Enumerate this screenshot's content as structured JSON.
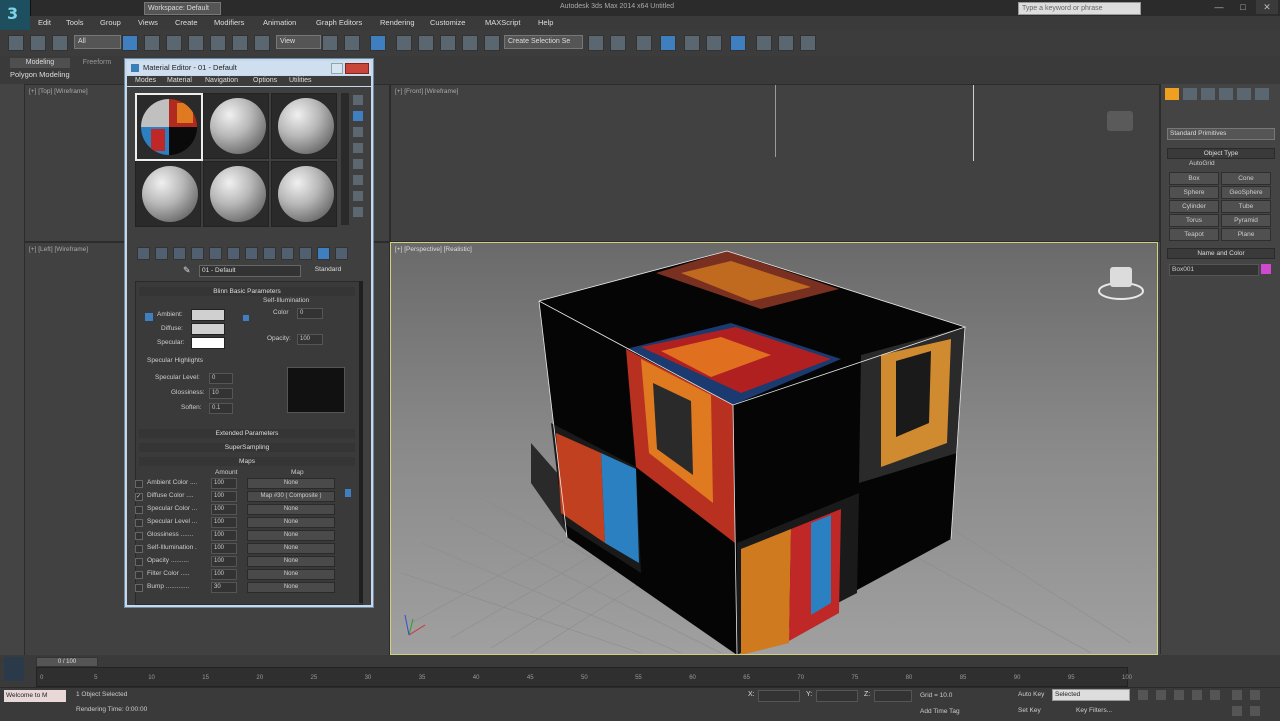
{
  "titlebar": {
    "workspace": "Workspace: Default",
    "app_title": "Autodesk 3ds Max 2014 x64     Untitled",
    "search_placeholder": "Type a keyword or phrase",
    "min": "—",
    "max": "□",
    "close": "✕"
  },
  "menu": [
    "Edit",
    "Tools",
    "Group",
    "Views",
    "Create",
    "Modifiers",
    "Animation",
    "Graph Editors",
    "Rendering",
    "Customize",
    "MAXScript",
    "Help"
  ],
  "toolbar": {
    "selection_filter": "All",
    "ref_coord": "View",
    "named_selection": "Create Selection Se"
  },
  "ribbon": {
    "tab_modeling": "Modeling",
    "tab_freeform": "Freeform",
    "poly_modeling": "Polygon Modeling"
  },
  "viewports": {
    "top": "[+] [Top] [Wireframe]",
    "front": "[+] [Front] [Wireframe]",
    "left": "[+] [Left] [Wireframe]",
    "persp": "[+] [Perspective] [Realistic]"
  },
  "command_panel": {
    "dropdown": "Standard Primitives",
    "object_type": "Object Type",
    "autogrid": "AutoGrid",
    "buttons": [
      "Box",
      "Cone",
      "Sphere",
      "GeoSphere",
      "Cylinder",
      "Tube",
      "Torus",
      "Pyramid",
      "Teapot",
      "Plane"
    ],
    "name_color": "Name and Color",
    "name_value": "Box001",
    "name_color_hex": "#d04ad0"
  },
  "material_editor": {
    "title": "Material Editor - 01 - Default",
    "menu": [
      "Modes",
      "Material",
      "Navigation",
      "Options",
      "Utilities"
    ],
    "material_name": "01 - Default",
    "material_type": "Standard",
    "blinn_basic": "Blinn Basic Parameters",
    "self_illum": "Self-Illumination",
    "ambient": "Ambient:",
    "diffuse": "Diffuse:",
    "specular": "Specular:",
    "color_label": "Color",
    "color_value": "0",
    "opacity_label": "Opacity:",
    "opacity_value": "100",
    "specular_highlights": "Specular Highlights",
    "spec_level": "Specular Level:",
    "spec_level_value": "0",
    "glossiness": "Glossiness:",
    "glossiness_value": "10",
    "soften": "Soften:",
    "soften_value": "0.1",
    "extended": "Extended Parameters",
    "supersampling": "SuperSampling",
    "maps": "Maps",
    "amount": "Amount",
    "map": "Map",
    "maps_rows": [
      {
        "name": "Ambient Color ....",
        "amount": "100",
        "map": "None",
        "checked": false
      },
      {
        "name": "Diffuse Color ....",
        "amount": "100",
        "map": "Map #30 ( Composite )",
        "checked": true
      },
      {
        "name": "Specular Color ...",
        "amount": "100",
        "map": "None",
        "checked": false
      },
      {
        "name": "Specular Level ...",
        "amount": "100",
        "map": "None",
        "checked": false
      },
      {
        "name": "Glossiness .......",
        "amount": "100",
        "map": "None",
        "checked": false
      },
      {
        "name": "Self-Illumination .",
        "amount": "100",
        "map": "None",
        "checked": false
      },
      {
        "name": "Opacity ..........",
        "amount": "100",
        "map": "None",
        "checked": false
      },
      {
        "name": "Filter Color .....",
        "amount": "100",
        "map": "None",
        "checked": false
      },
      {
        "name": "Bump .............",
        "amount": "30",
        "map": "None",
        "checked": false
      }
    ]
  },
  "timeline": {
    "frame": "0 / 100",
    "ticks": [
      "0",
      "5",
      "10",
      "15",
      "20",
      "25",
      "30",
      "35",
      "40",
      "45",
      "50",
      "55",
      "60",
      "65",
      "70",
      "75",
      "80",
      "85",
      "90",
      "95",
      "100"
    ]
  },
  "status": {
    "maxscript": "Welcome to M",
    "selected": "1 Object Selected",
    "render_time": "Rendering Time: 0:00:00",
    "x_label": "X:",
    "y_label": "Y:",
    "z_label": "Z:",
    "grid": "Grid = 10.0",
    "add_time_tag": "Add Time Tag",
    "auto_key": "Auto Key",
    "set_key": "Set Key",
    "selected_dd": "Selected",
    "key_filters": "Key Filters..."
  }
}
